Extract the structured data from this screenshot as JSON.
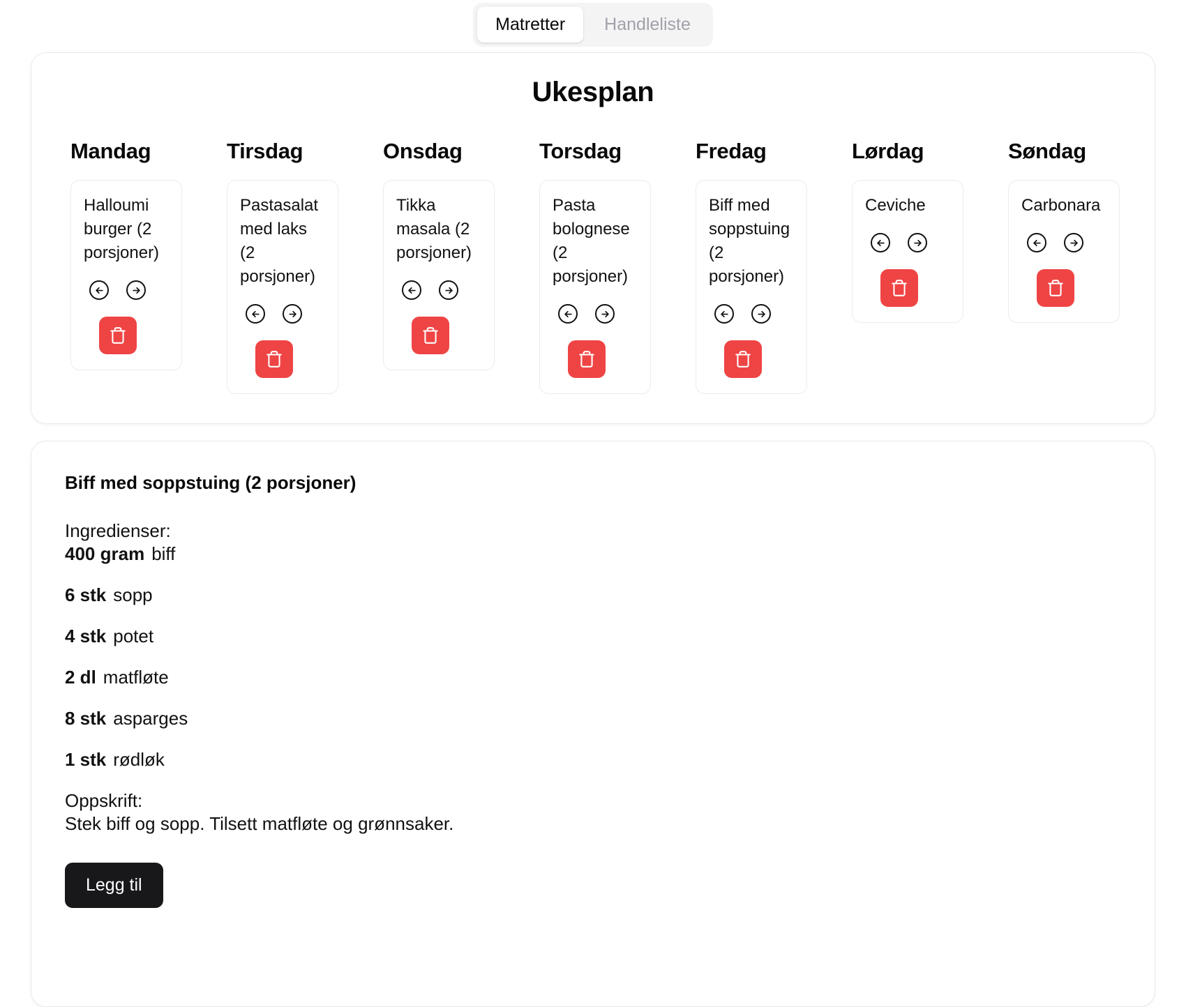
{
  "tabs": [
    {
      "label": "Matretter",
      "active": true
    },
    {
      "label": "Handleliste",
      "active": false
    }
  ],
  "week": {
    "title": "Ukesplan",
    "days": [
      {
        "name": "Mandag",
        "meal": "Halloumi burger (2 porsjoner)"
      },
      {
        "name": "Tirsdag",
        "meal": "Pastasalat med laks (2 porsjoner)"
      },
      {
        "name": "Onsdag",
        "meal": "Tikka masala (2 porsjoner)"
      },
      {
        "name": "Torsdag",
        "meal": "Pasta bolognese (2 porsjoner)"
      },
      {
        "name": "Fredag",
        "meal": "Biff med soppstuing (2 porsjoner)"
      },
      {
        "name": "Lørdag",
        "meal": "Ceviche"
      },
      {
        "name": "Søndag",
        "meal": "Carbonara"
      }
    ]
  },
  "recipe": {
    "title": "Biff med soppstuing (2 porsjoner)",
    "ingredients_label": "Ingredienser:",
    "ingredients": [
      {
        "amount": "400 gram",
        "name": "biff"
      },
      {
        "amount": "6 stk",
        "name": "sopp"
      },
      {
        "amount": "4 stk",
        "name": "potet"
      },
      {
        "amount": "2 dl",
        "name": "matfløte"
      },
      {
        "amount": "8 stk",
        "name": "asparges"
      },
      {
        "amount": "1 stk",
        "name": "rødløk"
      }
    ],
    "recipe_label": "Oppskrift:",
    "steps": "Stek biff og sopp. Tilsett matfløte og grønnsaker.",
    "add_label": "Legg til"
  },
  "colors": {
    "danger": "#ef4444",
    "dark": "#18181b",
    "tab_bg": "#f4f4f5",
    "muted": "#a1a1aa"
  }
}
